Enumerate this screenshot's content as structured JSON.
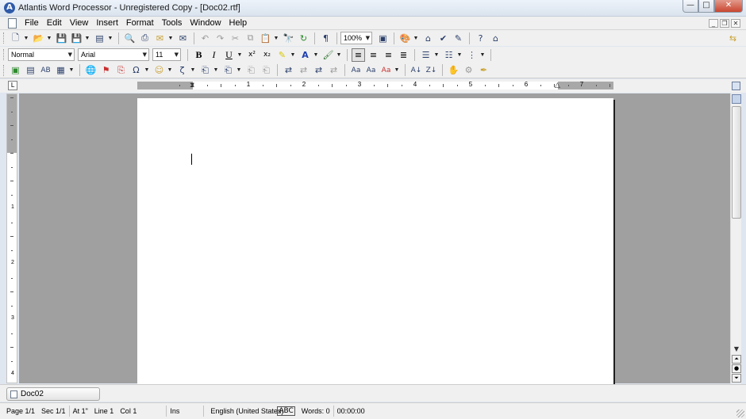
{
  "window": {
    "app_icon": "A",
    "title": "Atlantis Word Processor - Unregistered Copy - [Doc02.rtf]",
    "controls": {
      "minimize": "—",
      "maximize": "□",
      "close": "✕"
    }
  },
  "menubar": {
    "items": [
      "File",
      "Edit",
      "View",
      "Insert",
      "Format",
      "Tools",
      "Window",
      "Help"
    ],
    "mdi_controls": {
      "minimize": "_",
      "restore": "❐",
      "close": "✕"
    }
  },
  "toolbar1": {
    "zoom": "100%",
    "icons": [
      "new-document-icon",
      "open-icon",
      "save-icon",
      "save-as-icon",
      "templates-icon",
      "print-preview-icon",
      "print-icon",
      "email-icon",
      "fax-icon",
      "undo-icon",
      "redo-icon",
      "cut-icon",
      "copy-icon",
      "paste-icon",
      "find-icon",
      "replace-icon",
      "show-formatting-icon",
      "zoom-icon",
      "full-screen-icon",
      "styles-icon",
      "home-icon",
      "spellcheck-icon",
      "autocorrect-icon",
      "help-icon",
      "web-icon",
      "exit-icon"
    ]
  },
  "toolbar2": {
    "style": "Normal",
    "font": "Arial",
    "size": "11",
    "bold": "B",
    "italic": "I",
    "underline": "U",
    "superscript": "x²",
    "subscript": "x₂"
  },
  "ruler": {
    "numbers": [
      "1",
      "2",
      "3",
      "4",
      "5",
      "6",
      "7"
    ],
    "corner": "L"
  },
  "vertical_ruler": {
    "numbers": [
      "1",
      "2",
      "3",
      "4"
    ]
  },
  "document_tabs": [
    {
      "label": "Doc02"
    }
  ],
  "statusbar": {
    "page": "Page 1/1",
    "section": "Sec 1/1",
    "position": "At 1\"",
    "line": "Line 1",
    "column": "Col 1",
    "mode": "Ins",
    "language": "English (United States)",
    "words": "Words: 0",
    "time": "00:00:00"
  },
  "colors": {
    "workspace": "#a0a0a0",
    "page": "#ffffff",
    "chrome": "#f0f0f0",
    "close_button": "#c9452f"
  }
}
